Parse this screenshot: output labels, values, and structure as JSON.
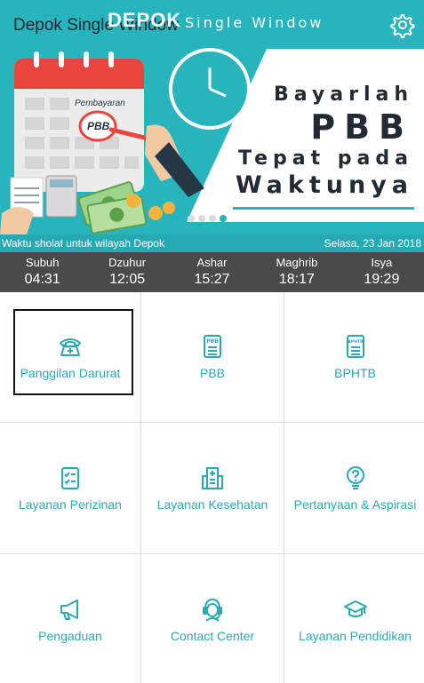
{
  "header": {
    "app_title": "Depok Single Window",
    "brand_logo": "DEPOK",
    "brand_subtitle": "Single Window",
    "settings_icon": "gear-icon"
  },
  "banner": {
    "illustration_label": "Pembayaran",
    "illustration_badge": "PBB",
    "slogan": [
      "Bayarlah",
      "PBB",
      "Tepat pada",
      "Waktunya"
    ],
    "pager": {
      "count": 4,
      "active_index": 3
    },
    "colors": {
      "teal": "#27b4bd",
      "dark": "#222b33"
    }
  },
  "prayer": {
    "location_text": "Waktu sholat untuk wilayah Depok",
    "date_text": "Selasa, 23 Jan 2018",
    "times": [
      {
        "name": "Subuh",
        "time": "04:31"
      },
      {
        "name": "Dzuhur",
        "time": "12:05"
      },
      {
        "name": "Ashar",
        "time": "15:27"
      },
      {
        "name": "Maghrib",
        "time": "18:17"
      },
      {
        "name": "Isya",
        "time": "19:29"
      }
    ]
  },
  "menu": [
    {
      "label": "Panggilan Darurat",
      "icon": "phone-icon"
    },
    {
      "label": "PBB",
      "icon": "pbb-document-icon"
    },
    {
      "label": "BPHTB",
      "icon": "bphtb-document-icon"
    },
    {
      "label": "Layanan Perizinan",
      "icon": "checklist-icon"
    },
    {
      "label": "Layanan Kesehatan",
      "icon": "hospital-icon"
    },
    {
      "label": "Pertanyaan & Aspirasi",
      "icon": "question-bulb-icon"
    },
    {
      "label": "Pengaduan",
      "icon": "megaphone-icon"
    },
    {
      "label": "Contact Center",
      "icon": "headset-agent-icon"
    },
    {
      "label": "Layanan Pendidikan",
      "icon": "graduation-cap-icon"
    }
  ]
}
